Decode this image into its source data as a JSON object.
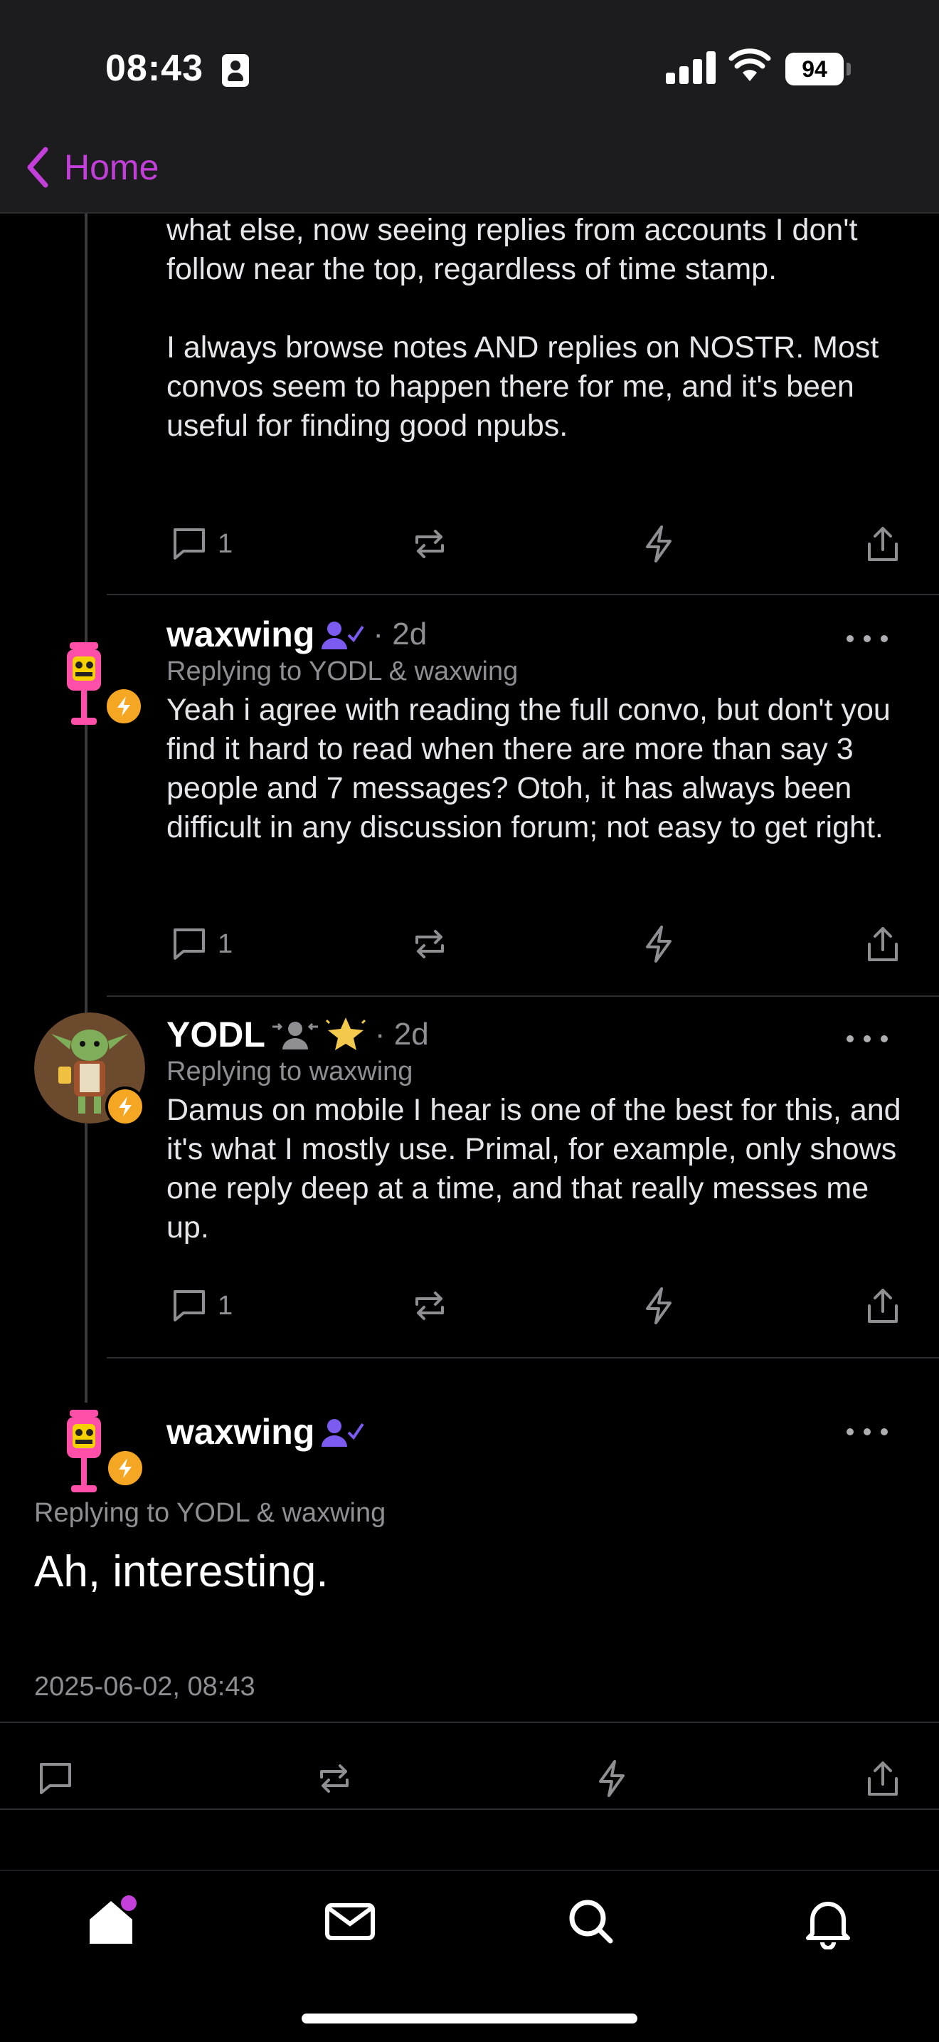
{
  "status_bar": {
    "time": "08:43",
    "battery": "94"
  },
  "nav": {
    "back_label": "Home"
  },
  "thread": [
    {
      "text": "what else, now seeing replies from accounts I don't follow near the top, regardless of time stamp.\n\nI always browse notes AND replies on NOSTR. Most convos seem to happen there for me, and it's been useful for finding good npubs.",
      "reply_count": "1"
    },
    {
      "author": "waxwing",
      "time_ago": "· 2d",
      "replying_to": "Replying to YODL & waxwing",
      "text": "Yeah i agree with reading the full convo, but don't you find it hard to read when there are more than say 3 people and 7 messages? Otoh, it has always been difficult in any discussion forum; not easy to get right.",
      "reply_count": "1"
    },
    {
      "author": "YODL",
      "time_ago": "· 2d",
      "replying_to": "Replying to waxwing",
      "text": "Damus on mobile I hear is one of the best for this, and it's what I mostly use. Primal, for example, only shows one reply deep at a time, and that really messes me up.",
      "reply_count": "1"
    }
  ],
  "focused_post": {
    "author": "waxwing",
    "replying_to": "Replying to YODL & waxwing",
    "text": "Ah, interesting.",
    "timestamp": "2025-06-02, 08:43"
  },
  "colors": {
    "accent": "#c33fd9",
    "zap": "#f5a623",
    "verified": "#7c5cf0",
    "muted": "#8e8e93"
  },
  "icons": [
    "chevron-left-icon",
    "reply-icon",
    "repost-icon",
    "zap-icon",
    "share-icon",
    "more-icon",
    "home-icon",
    "mail-icon",
    "search-icon",
    "bell-icon"
  ]
}
